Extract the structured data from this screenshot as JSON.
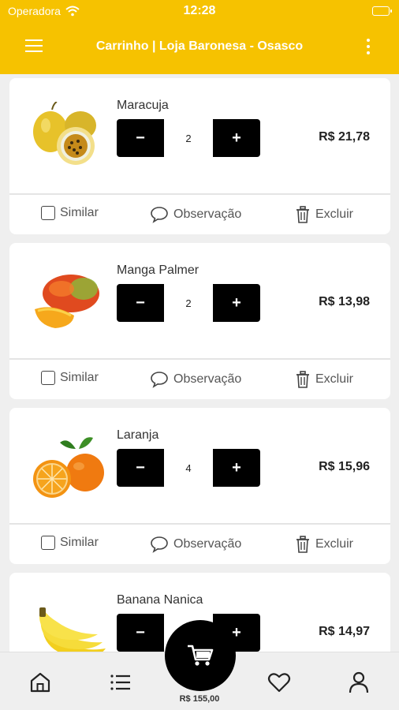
{
  "status_bar": {
    "carrier": "Operadora",
    "time": "12:28"
  },
  "header": {
    "title": "Carrinho | Loja Baronesa - Osasco"
  },
  "actions": {
    "similar": "Similar",
    "observation": "Observação",
    "delete": "Excluir"
  },
  "stepper": {
    "minus": "−",
    "plus": "+"
  },
  "cart_items": [
    {
      "name": "Maracuja",
      "quantity": "2",
      "price": "R$ 21,78",
      "image": "passion-fruit"
    },
    {
      "name": "Manga Palmer",
      "quantity": "2",
      "price": "R$ 13,98",
      "image": "mango"
    },
    {
      "name": "Laranja",
      "quantity": "4",
      "price": "R$ 15,96",
      "image": "orange"
    },
    {
      "name": "Banana Nanica",
      "quantity": "",
      "price": "R$ 14,97",
      "image": "banana"
    }
  ],
  "bottom_nav": {
    "cart_total": "R$ 155,00",
    "items": [
      "home-icon",
      "list-icon",
      "cart-icon",
      "heart-icon",
      "user-icon"
    ]
  },
  "colors": {
    "brand": "#f6c200",
    "button": "#000000",
    "background": "#efefef"
  }
}
